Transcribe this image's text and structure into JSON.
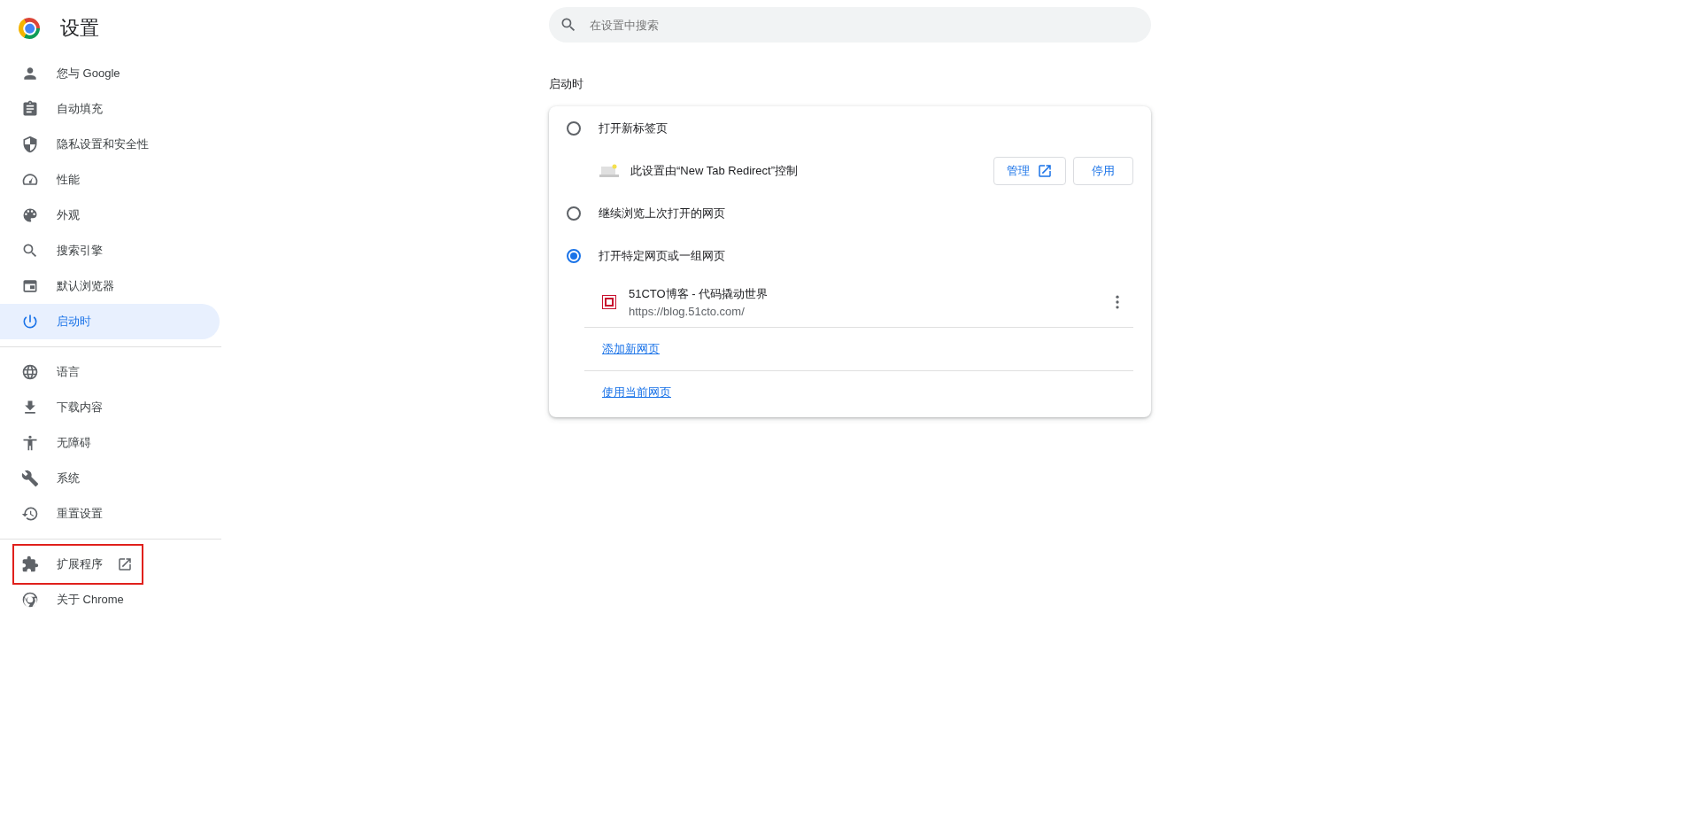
{
  "app": {
    "title": "设置"
  },
  "sidebar": {
    "groups": [
      {
        "items": [
          {
            "label": "您与 Google",
            "selected": false,
            "external": false,
            "highlighted": false
          },
          {
            "label": "自动填充",
            "selected": false,
            "external": false,
            "highlighted": false
          },
          {
            "label": "隐私设置和安全性",
            "selected": false,
            "external": false,
            "highlighted": false
          },
          {
            "label": "性能",
            "selected": false,
            "external": false,
            "highlighted": false
          },
          {
            "label": "外观",
            "selected": false,
            "external": false,
            "highlighted": false
          },
          {
            "label": "搜索引擎",
            "selected": false,
            "external": false,
            "highlighted": false
          },
          {
            "label": "默认浏览器",
            "selected": false,
            "external": false,
            "highlighted": false
          },
          {
            "label": "启动时",
            "selected": true,
            "external": false,
            "highlighted": false
          }
        ]
      },
      {
        "items": [
          {
            "label": "语言",
            "selected": false,
            "external": false,
            "highlighted": false
          },
          {
            "label": "下载内容",
            "selected": false,
            "external": false,
            "highlighted": false
          },
          {
            "label": "无障碍",
            "selected": false,
            "external": false,
            "highlighted": false
          },
          {
            "label": "系统",
            "selected": false,
            "external": false,
            "highlighted": false
          },
          {
            "label": "重置设置",
            "selected": false,
            "external": false,
            "highlighted": false
          }
        ]
      },
      {
        "items": [
          {
            "label": "扩展程序",
            "selected": false,
            "external": true,
            "highlighted": true
          },
          {
            "label": "关于 Chrome",
            "selected": false,
            "external": false,
            "highlighted": false
          }
        ]
      }
    ]
  },
  "search": {
    "placeholder": "在设置中搜索"
  },
  "startup": {
    "heading": "启动时",
    "options": [
      {
        "label": "打开新标签页",
        "selected": false,
        "notice": {
          "text": "此设置由“New Tab Redirect”控制",
          "buttons": [
            {
              "label": "管理",
              "external": true
            },
            {
              "label": "停用",
              "external": false
            }
          ]
        }
      },
      {
        "label": "继续浏览上次打开的网页",
        "selected": false
      },
      {
        "label": "打开特定网页或一组网页",
        "selected": true,
        "pages": [
          {
            "title": "51CTO博客 - 代码撬动世界",
            "url": "https://blog.51cto.com/"
          }
        ],
        "links": [
          "添加新网页",
          "使用当前网页"
        ]
      }
    ]
  }
}
